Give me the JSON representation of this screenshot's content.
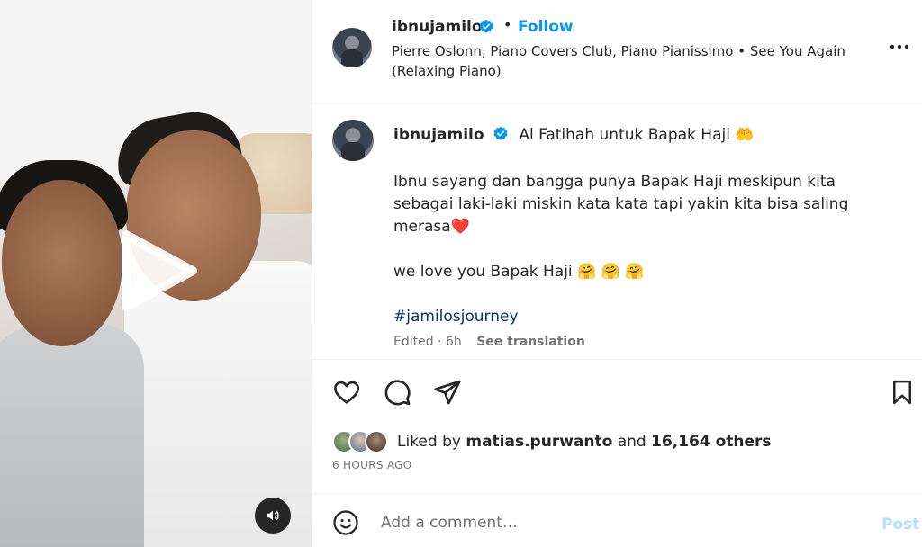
{
  "post": {
    "username": "ibnujamilo",
    "follow_label": "Follow",
    "dot": "•",
    "audio": "Pierre Oslonn, Piano Covers Club, Piano Pianissimo • See You Again (Relaxing Piano)",
    "caption": {
      "first_line": "Al Fatihah untuk Bapak Haji 🤲",
      "para1": "Ibnu sayang dan bangga punya Bapak Haji meskipun kita sebagai laki-laki miskin kata kata tapi yakin kita bisa saling merasa❤️",
      "para2": "we love you Bapak Haji 🤗 🤗 🤗",
      "hashtag": "#jamilosjourney",
      "edited": "Edited · 6h",
      "see_translation": "See translation"
    },
    "likes": {
      "prefix": "Liked by",
      "user": "matias.purwanto",
      "middle": "and",
      "count": "16,164 others"
    },
    "time_ago": "6 HOURS AGO",
    "comment": {
      "placeholder": "Add a comment…",
      "post_label": "Post"
    }
  },
  "icons": {
    "verified": "verified-badge-icon",
    "more": "more-options-icon",
    "like": "heart-icon",
    "comment": "comment-bubble-icon",
    "share": "paper-plane-icon",
    "save": "bookmark-icon",
    "emoji": "smiley-icon",
    "play": "play-icon",
    "audio": "speaker-icon"
  },
  "colors": {
    "link": "#0095f6",
    "hashtag": "#00376b",
    "muted": "#737373",
    "post_disabled": "#b2dffc"
  }
}
